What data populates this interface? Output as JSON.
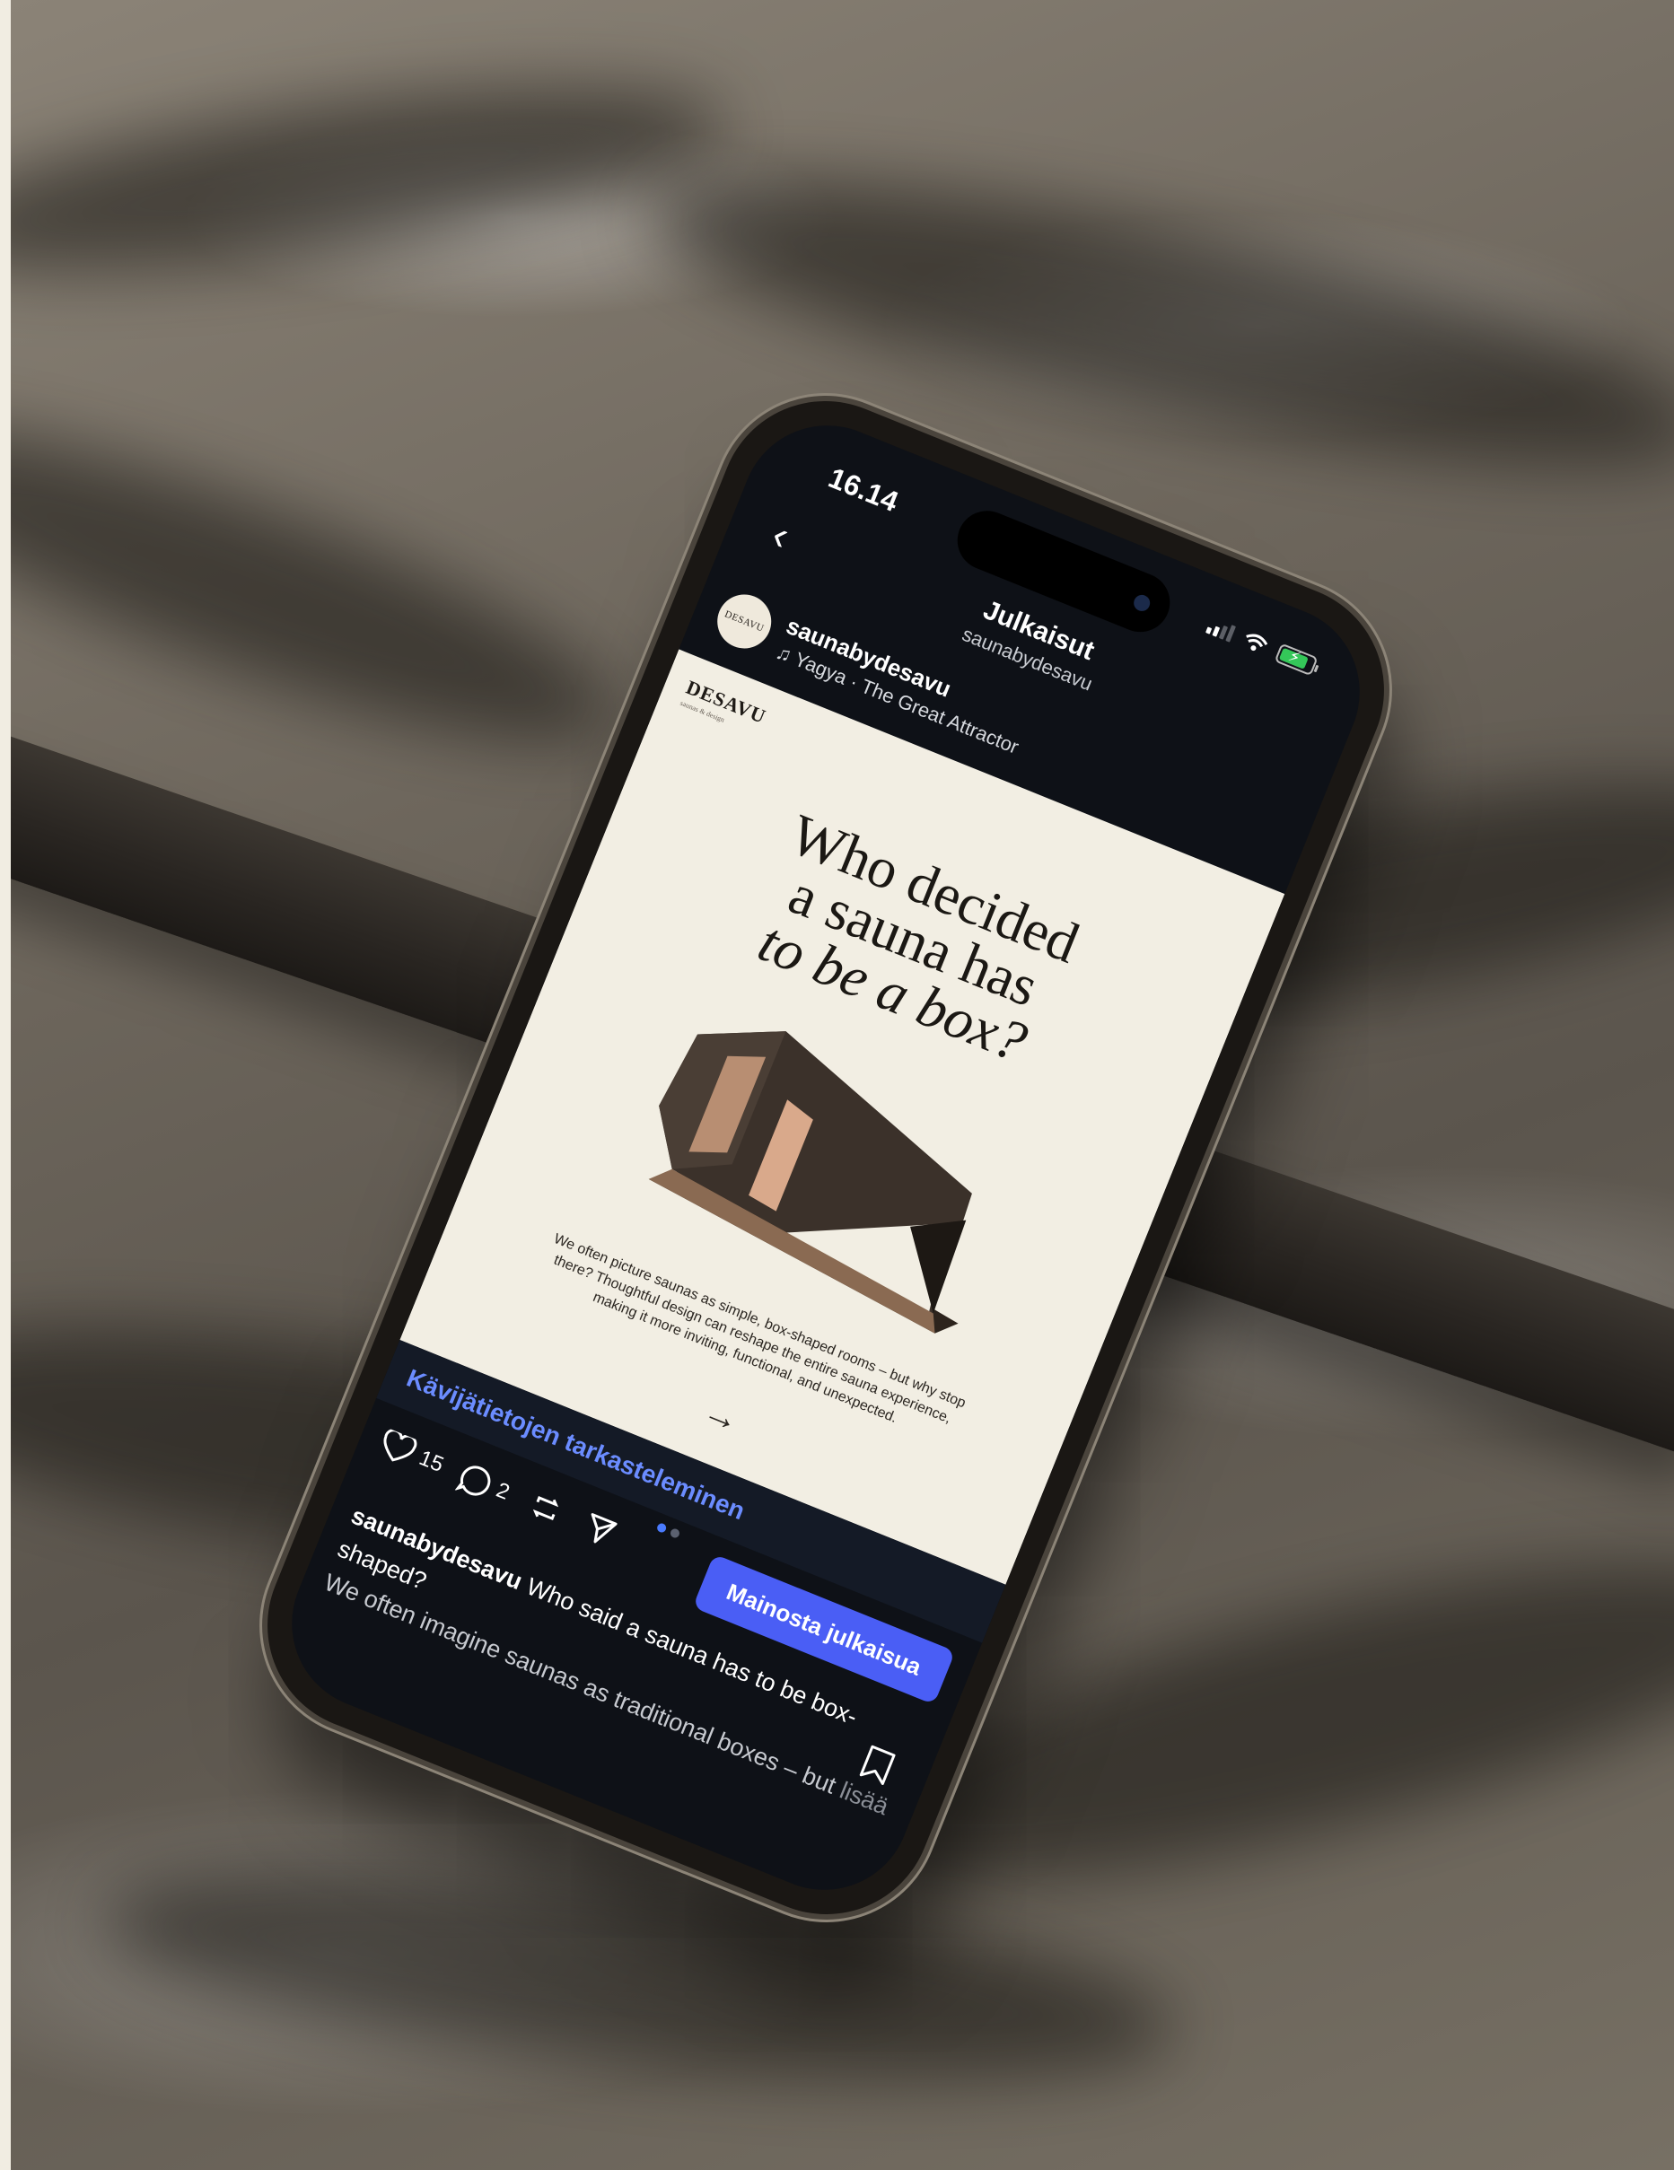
{
  "status_bar": {
    "time": "16.14"
  },
  "nav": {
    "title": "Julkaisut",
    "subtitle": "saunabydesavu"
  },
  "post_header": {
    "avatar_text": "DESAVU",
    "username": "saunabydesavu",
    "music_note": "♫",
    "music": "Yagya · The Great Attractor",
    "more": "···"
  },
  "post_image": {
    "brand": "DESAVU",
    "brand_sub": "saunas & design",
    "headline_line1": "Who decided",
    "headline_line2": "a sauna has",
    "headline_line3": "to be a box?",
    "blurb": "We often picture saunas as simple, box-shaped rooms – but why stop there? Thoughtful design can reshape the entire sauna experience, making it more inviting, functional, and unexpected.",
    "arrow": "→"
  },
  "insights_link": "Kävijätietojen tarkasteleminen",
  "actions": {
    "likes": "15",
    "comments": "2",
    "promote_label": "Mainosta julkaisua"
  },
  "carousel": {
    "count": 2,
    "active": 1
  },
  "caption": {
    "username": "saunabydesavu",
    "text": "Who said a sauna has to be box-shaped?",
    "continuation": "We often imagine saunas as traditional boxes – but",
    "more": "lisää"
  },
  "icons": [
    "back-chevron-icon",
    "signal-icon",
    "wifi-icon",
    "battery-icon",
    "music-note-icon",
    "more-icon",
    "heart-icon",
    "comment-icon",
    "repost-icon",
    "share-icon",
    "bookmark-icon"
  ],
  "colors": {
    "accent_blue": "#4a5ef5",
    "link_blue": "#6b8cff",
    "screen_bg": "#0e1117",
    "post_bg": "#f2eee3"
  }
}
